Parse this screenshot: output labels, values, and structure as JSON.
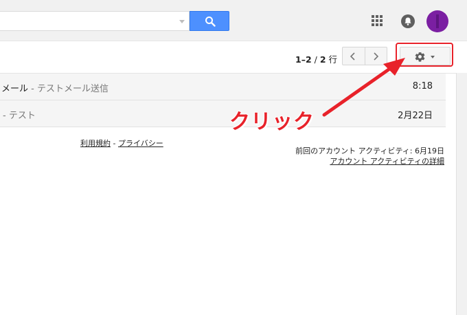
{
  "header": {
    "search": {
      "value": "",
      "placeholder": ""
    },
    "icons": {
      "search": "search-icon",
      "apps": "apps-grid-icon",
      "notifications": "bell-icon",
      "avatar": "avatar"
    },
    "avatar_color": "#7b1fa2"
  },
  "toolbar": {
    "range": "1–2",
    "separator": " / ",
    "total": "2",
    "unit": " 行"
  },
  "mail": [
    {
      "subject": "メール",
      "snippet": " - テストメール送信",
      "date": "8:18"
    },
    {
      "subject": "",
      "snippet": "- テスト",
      "date": "2月22日"
    }
  ],
  "footer": {
    "terms": "利用規約",
    "dash": " - ",
    "privacy": "プライバシー",
    "last_activity": "前回のアカウント アクティビティ: 6月19日",
    "details": "アカウント アクティビティの詳細"
  },
  "annotation": {
    "label": "クリック",
    "color": "#e8222a"
  }
}
